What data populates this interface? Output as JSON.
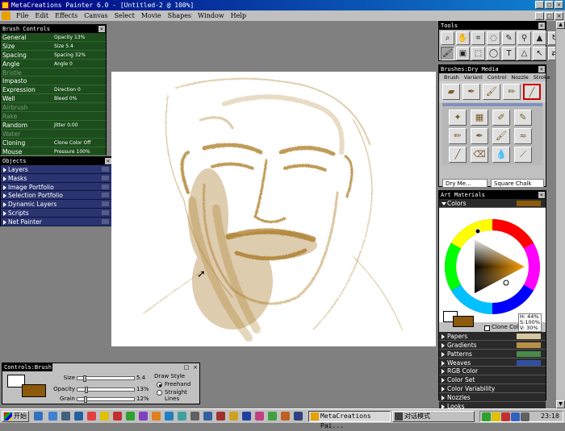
{
  "window": {
    "title": "MetaCreations Painter 6.0 - [Untitled-2 @ 100%]"
  },
  "menu": [
    "File",
    "Edit",
    "Effects",
    "Canvas",
    "Select",
    "Movie",
    "Shapes",
    "Window",
    "Help"
  ],
  "brush_controls": {
    "title": "Brush Controls",
    "rows": [
      {
        "label": "General",
        "value": "Opacity 13%",
        "dim": false
      },
      {
        "label": "Size",
        "value": "Size 5.4",
        "dim": false
      },
      {
        "label": "Spacing",
        "value": "Spacing 32%",
        "dim": false
      },
      {
        "label": "Angle",
        "value": "Angle 0",
        "dim": false
      },
      {
        "label": "Bristle",
        "value": "",
        "dim": true
      },
      {
        "label": "Impasto",
        "value": "",
        "dim": false
      },
      {
        "label": "Expression",
        "value": "Direction 0",
        "dim": false
      },
      {
        "label": "Well",
        "value": "Bleed 0%",
        "dim": false
      },
      {
        "label": "Airbrush",
        "value": "",
        "dim": true
      },
      {
        "label": "Rake",
        "value": "",
        "dim": true
      },
      {
        "label": "Random",
        "value": "Jitter 0.00",
        "dim": false
      },
      {
        "label": "Water",
        "value": "",
        "dim": true
      },
      {
        "label": "Cloning",
        "value": "Clone Color Off",
        "dim": false
      },
      {
        "label": "Mouse",
        "value": "Pressure 100%",
        "dim": false
      }
    ]
  },
  "objects": {
    "title": "Objects",
    "rows": [
      "Layers",
      "Masks",
      "Image Portfolio",
      "Selection Portfolio",
      "Dynamic Layers",
      "Scripts",
      "Net Painter"
    ]
  },
  "tools": {
    "title": "Tools"
  },
  "brushes": {
    "title": "Brushes:Dry Media",
    "tabs": [
      "Brush",
      "Variant",
      "Control",
      "Nozzle",
      "Stroke"
    ],
    "category": "Dry Me...",
    "variant": "Square Chalk"
  },
  "art_materials": {
    "title": "Art Materials",
    "colors_label": "Colors",
    "hsv": {
      "h": "H: 44%",
      "s": "S:100%",
      "v": "V: 30%"
    },
    "clone_color": "Clone Color",
    "rows": [
      {
        "label": "Papers",
        "swatch": "#d8c8a0"
      },
      {
        "label": "Gradients",
        "swatch": "#b89048"
      },
      {
        "label": "Patterns",
        "swatch": "#4a8a4a"
      },
      {
        "label": "Weaves",
        "swatch": "#3050a0"
      },
      {
        "label": "RGB Color",
        "swatch": ""
      },
      {
        "label": "Color Set",
        "swatch": ""
      },
      {
        "label": "Color Variability",
        "swatch": ""
      },
      {
        "label": "Nozzles",
        "swatch": ""
      },
      {
        "label": "Looks",
        "swatch": ""
      }
    ],
    "primary_color": "#8b5a0a"
  },
  "controls_brush": {
    "title": "Controls:Brush",
    "size": {
      "label": "Size",
      "value": "5.4",
      "frac": 0.1
    },
    "opacity": {
      "label": "Opacity",
      "value": "13%",
      "frac": 0.13
    },
    "grain": {
      "label": "Grain",
      "value": "12%",
      "frac": 0.12
    },
    "draw_style": "Draw Style",
    "freehand": "Freehand",
    "straight": "Straight Lines"
  },
  "taskbar": {
    "start": "开始",
    "tasks": [
      "MetaCreations Pai...",
      "对话模式"
    ],
    "clock": "23:18"
  }
}
